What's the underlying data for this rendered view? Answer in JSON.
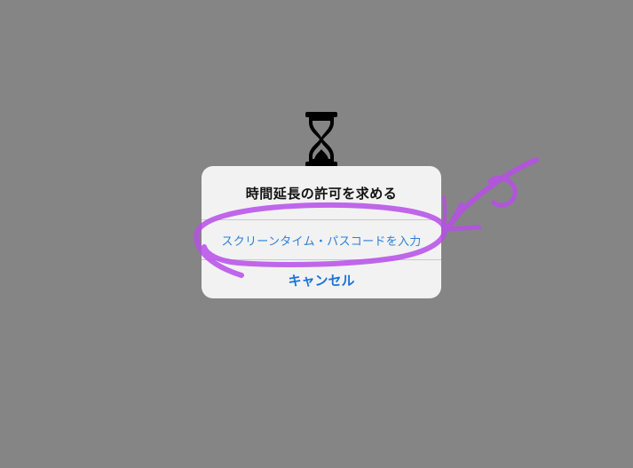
{
  "background_color": "#858585",
  "icon": {
    "name": "hourglass-icon"
  },
  "alert": {
    "title": "時間延長の許可を求める",
    "passcode_button": "スクリーンタイム・パスコードを入力",
    "cancel_button": "キャンセル"
  },
  "annotation": {
    "color": "#b74ee8",
    "shapes": [
      "circle-highlight",
      "arrow"
    ]
  }
}
